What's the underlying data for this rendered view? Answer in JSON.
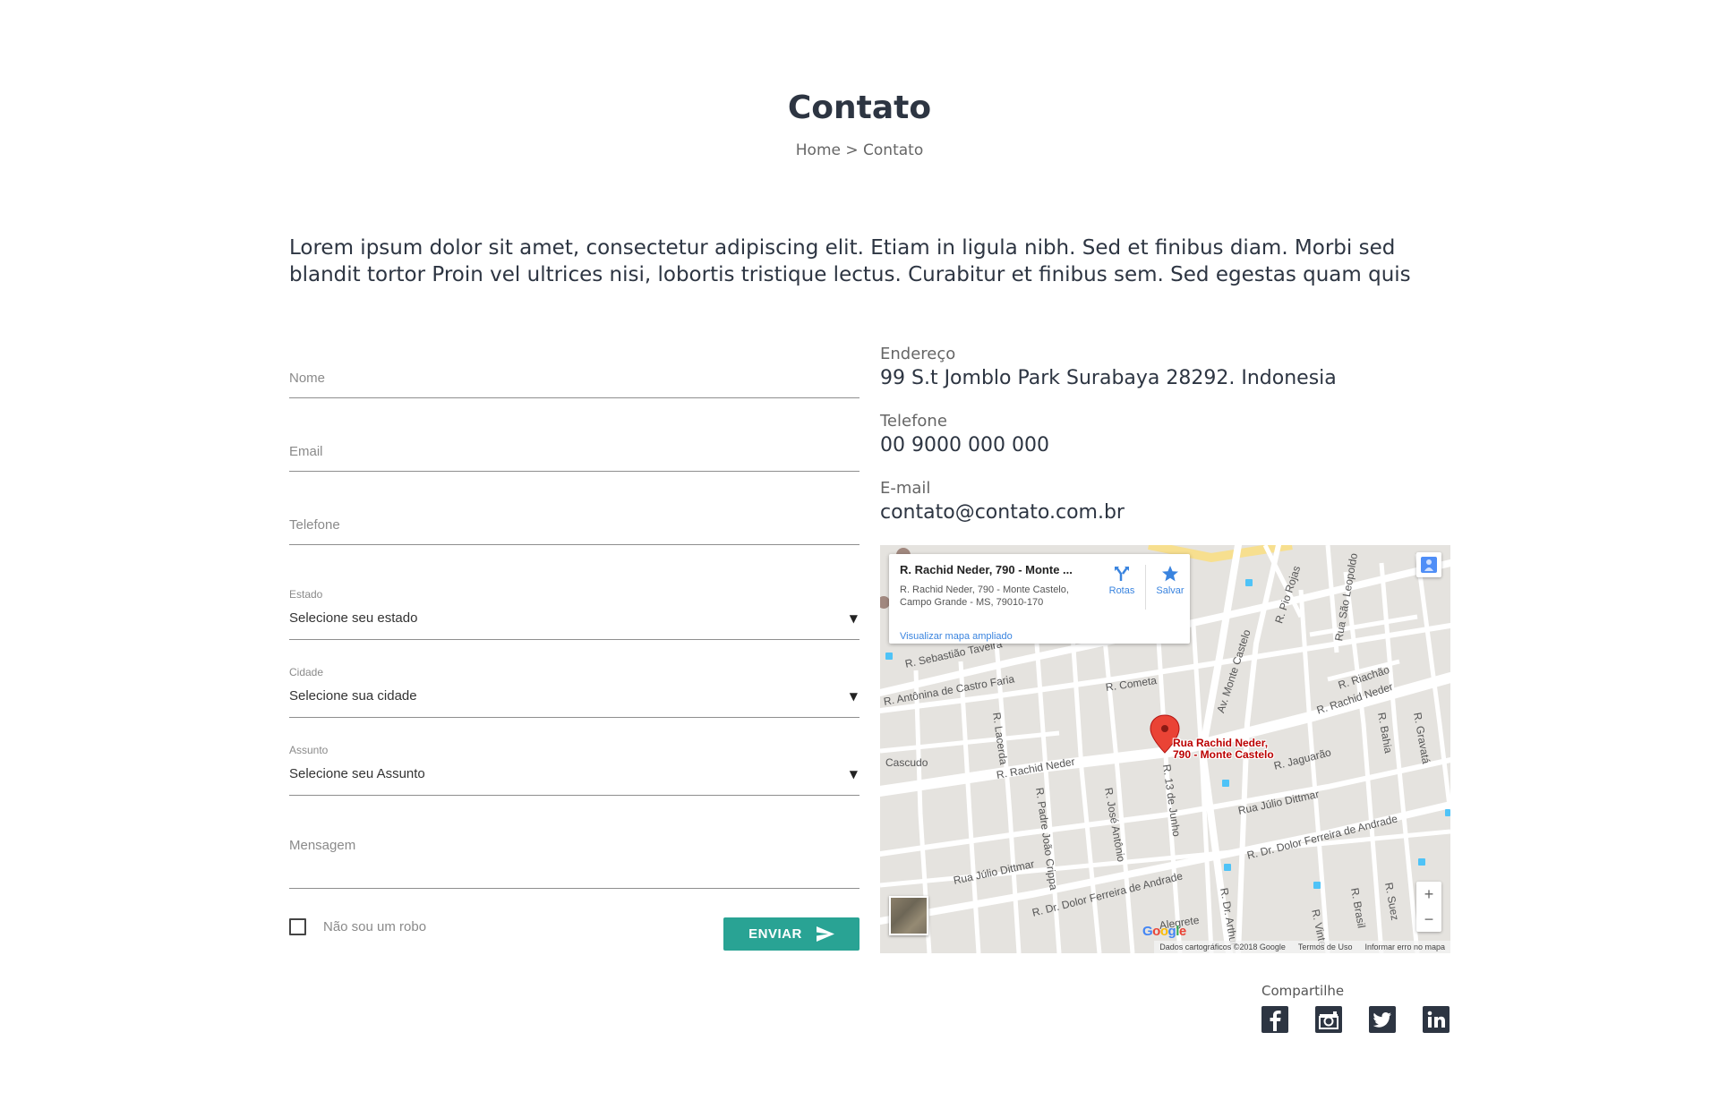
{
  "header": {
    "title": "Contato",
    "breadcrumb": "Home > Contato"
  },
  "intro": "Lorem ipsum dolor sit amet, consectetur adipiscing elit. Etiam in ligula nibh. Sed et finibus diam. Morbi sed blandit tortor Proin vel ultrices nisi, lobortis tristique lectus. Curabitur et finibus sem. Sed egestas quam quis",
  "form": {
    "nome_placeholder": "Nome",
    "email_placeholder": "Email",
    "telefone_placeholder": "Telefone",
    "estado": {
      "label": "Estado",
      "value": "Selecione seu estado"
    },
    "cidade": {
      "label": "Cidade",
      "value": "Selecione sua cidade"
    },
    "assunto": {
      "label": "Assunto",
      "value": "Selecione seu Assunto"
    },
    "mensagem_placeholder": "Mensagem",
    "robot_label": "Não sou um robo",
    "submit_label": "ENVIAR"
  },
  "contact": {
    "address_label": "Endereço",
    "address": "99 S.t Jomblo Park Surabaya 28292. Indonesia",
    "phone_label": "Telefone",
    "phone": "00 9000 000 000",
    "email_label": "E-mail",
    "email": "contato@contato.com.br"
  },
  "map": {
    "info_title": "R. Rachid Neder, 790 - Monte ...",
    "info_address_line1": "R. Rachid Neder, 790 - Monte Castelo,",
    "info_address_line2": "Campo Grande - MS, 79010-170",
    "directions_label": "Rotas",
    "save_label": "Salvar",
    "larger_map_link": "Visualizar mapa ampliado",
    "pin_label_line1": "Rua Rachid Neder,",
    "pin_label_line2": "790 - Monte Castelo",
    "footer_data": "Dados cartográficos ©2018 Google",
    "footer_terms": "Termos de Uso",
    "footer_report": "Informar erro no mapa",
    "zoom_in": "+",
    "zoom_out": "−",
    "street_labels": [
      "R. Sebastião Taveira",
      "R. Antônina de Castro Faria",
      "R. Cometa",
      "R. Rachid Neder",
      "R. Rachid Neder",
      "R. Jaguarão",
      "Rua Júlio Dittmar",
      "Rua Júlio Dittmar",
      "R. Dr. Dolor Ferreira de Andrade",
      "R. Dr. Dolor Ferreira de Andrade",
      "R. Lacerda",
      "R. Padre João Crippa",
      "R. José Antônio",
      "R. 13 de Junho",
      "Av. Monte Castelo",
      "R. Pio Rojas",
      "R. Riachão",
      "R. Bahia",
      "Cascudo",
      "Rua São Leopoldo",
      "R. Gravatá",
      "R. Dr. Arthur",
      "R. Brasil",
      "Alegrete",
      "R. Suez",
      "R. Vinte"
    ]
  },
  "share": {
    "label": "Compartilhe",
    "icons": [
      "facebook-icon",
      "instagram-icon",
      "twitter-icon",
      "linkedin-icon"
    ]
  },
  "colors": {
    "accent": "#29a394",
    "text": "#2d3542"
  }
}
